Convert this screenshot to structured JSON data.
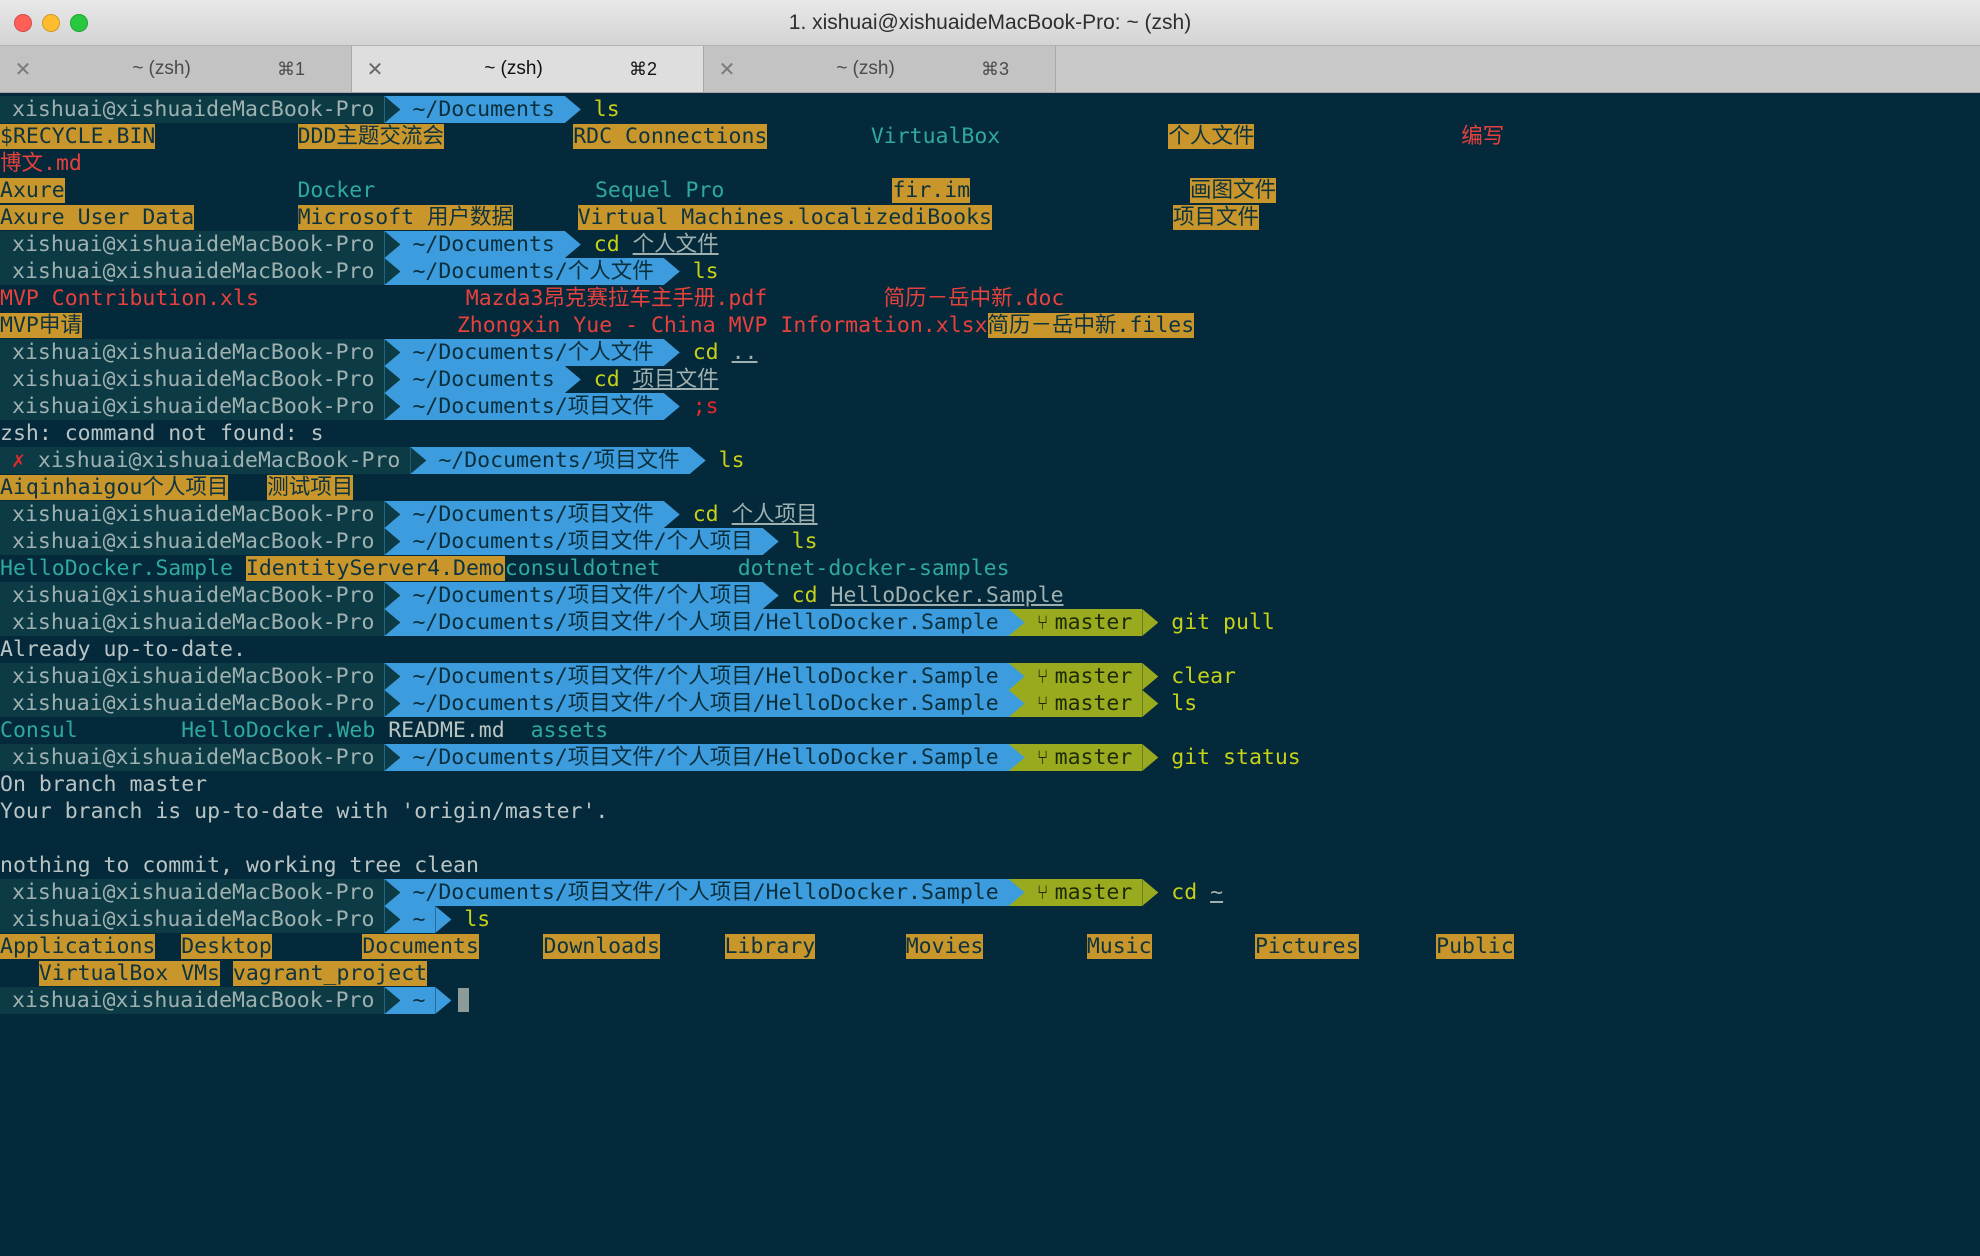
{
  "window": {
    "title": "1. xishuai@xishuaideMacBook-Pro: ~ (zsh)",
    "traffic_lights": [
      "close",
      "minimize",
      "zoom"
    ],
    "colors": {
      "terminal_bg": "#04293a",
      "host_segment": "#0d3b45",
      "path_segment": "#3c9cdd",
      "git_segment": "#9aaa1e",
      "dir_highlight": "#c8962a",
      "command": "#c6d117",
      "exec_file": "#2aa198",
      "red_file": "#e8413d",
      "text": "#b9c4c4"
    }
  },
  "tabs": [
    {
      "close": "✕",
      "title": "~ (zsh)",
      "key": "⌘1",
      "active": false
    },
    {
      "close": "✕",
      "title": "~ (zsh)",
      "key": "⌘2",
      "active": true
    },
    {
      "close": "✕",
      "title": "~ (zsh)",
      "key": "⌘3",
      "active": false
    }
  ],
  "prompt": {
    "host": "xishuai@xishuaideMacBook-Pro",
    "error_mark": "✗",
    "branch_icon": "⑂",
    "branch": "master",
    "cwd_home": "~",
    "cwd_documents": "~/Documents",
    "cwd_personal": "~/Documents/个人文件",
    "cwd_projects": "~/Documents/项目文件",
    "cwd_personal_projects": "~/Documents/项目文件/个人项目",
    "cwd_hellodocker": "~/Documents/项目文件/个人项目/HelloDocker.Sample"
  },
  "commands": {
    "ls": "ls",
    "cd": "cd",
    "cd_personal_arg": "个人文件",
    "cd_up_arg": "..",
    "cd_projects_arg": "项目文件",
    "bad_cmd": ";s",
    "cd_personal_projects_arg": "个人项目",
    "cd_hellodocker_arg": "HelloDocker.Sample",
    "git_pull": "git pull",
    "clear": "clear",
    "git_status": "git status",
    "cd_home": "cd",
    "cd_home_arg": "~"
  },
  "outputs": {
    "documents_ls": {
      "row1": [
        {
          "text": "$RECYCLE.BIN",
          "style": "dir-hl"
        },
        {
          "text": "DDD主题交流会",
          "style": "dir-hl"
        },
        {
          "text": "RDC Connections",
          "style": "dir-hl"
        },
        {
          "text": "VirtualBox",
          "style": "teal"
        },
        {
          "text": "个人文件",
          "style": "dir-hl"
        },
        {
          "text": "编写",
          "style": "red-txt"
        }
      ],
      "row2": [
        {
          "text": "博文.md",
          "style": "red-txt"
        }
      ],
      "row3": [
        {
          "text": "Axure",
          "style": "dir-hl"
        },
        {
          "text": "Docker",
          "style": "teal"
        },
        {
          "text": "Sequel Pro",
          "style": "teal"
        },
        {
          "text": "fir.im",
          "style": "dir-hl"
        },
        {
          "text": "画图文件",
          "style": "dir-hl"
        }
      ],
      "row4": [
        {
          "text": "Axure User Data",
          "style": "dir-hl"
        },
        {
          "text": "Microsoft 用户数据",
          "style": "dir-hl"
        },
        {
          "text": "Virtual Machines.localized",
          "style": "dir-hl"
        },
        {
          "text": "iBooks",
          "style": "dir-hl"
        },
        {
          "text": "项目文件",
          "style": "dir-hl"
        }
      ]
    },
    "personal_ls": {
      "row1": [
        {
          "text": "MVP Contribution.xls",
          "style": "red-txt"
        },
        {
          "text": "Mazda3昂克赛拉车主手册.pdf",
          "style": "red-txt"
        },
        {
          "text": "简历－岳中新.doc",
          "style": "red-txt"
        }
      ],
      "row2": [
        {
          "text": "MVP申请",
          "style": "dir-hl"
        },
        {
          "text": "Zhongxin Yue - China MVP Information.xlsx",
          "style": "red-txt"
        },
        {
          "text": "简历－岳中新.files",
          "style": "dir-hl"
        }
      ]
    },
    "cmd_not_found": "zsh: command not found: s",
    "projects_ls": [
      {
        "text": "Aiqinhaigou",
        "style": "dir-hl"
      },
      {
        "text": "个人项目",
        "style": "dir-hl"
      },
      {
        "text": "测试项目",
        "style": "dir-hl"
      }
    ],
    "personal_projects_ls": [
      {
        "text": "HelloDocker.Sample",
        "style": "teal"
      },
      {
        "text": "IdentityServer4.Demo",
        "style": "dir-hl"
      },
      {
        "text": "consuldotnet",
        "style": "teal"
      },
      {
        "text": "dotnet-docker-samples",
        "style": "teal"
      }
    ],
    "git_pull_result": "Already up-to-date.",
    "hellodocker_ls": [
      {
        "text": "Consul",
        "style": "teal"
      },
      {
        "text": "HelloDocker.Web",
        "style": "teal"
      },
      {
        "text": "README.md",
        "style": "plain"
      },
      {
        "text": "assets",
        "style": "teal"
      }
    ],
    "git_status": [
      "On branch master",
      "Your branch is up-to-date with 'origin/master'.",
      "",
      "nothing to commit, working tree clean"
    ],
    "home_ls_row1": [
      {
        "text": "Applications",
        "style": "dir-hl"
      },
      {
        "text": "Desktop",
        "style": "dir-hl"
      },
      {
        "text": "Documents",
        "style": "dir-hl"
      },
      {
        "text": "Downloads",
        "style": "dir-hl"
      },
      {
        "text": "Library",
        "style": "dir-hl"
      },
      {
        "text": "Movies",
        "style": "dir-hl"
      },
      {
        "text": "Music",
        "style": "dir-hl"
      },
      {
        "text": "Pictures",
        "style": "dir-hl"
      },
      {
        "text": "Public",
        "style": "dir-hl"
      }
    ],
    "home_ls_row2": [
      {
        "text": "VirtualBox VMs",
        "style": "dir-hl"
      },
      {
        "text": "vagrant_project",
        "style": "dir-hl"
      }
    ]
  }
}
